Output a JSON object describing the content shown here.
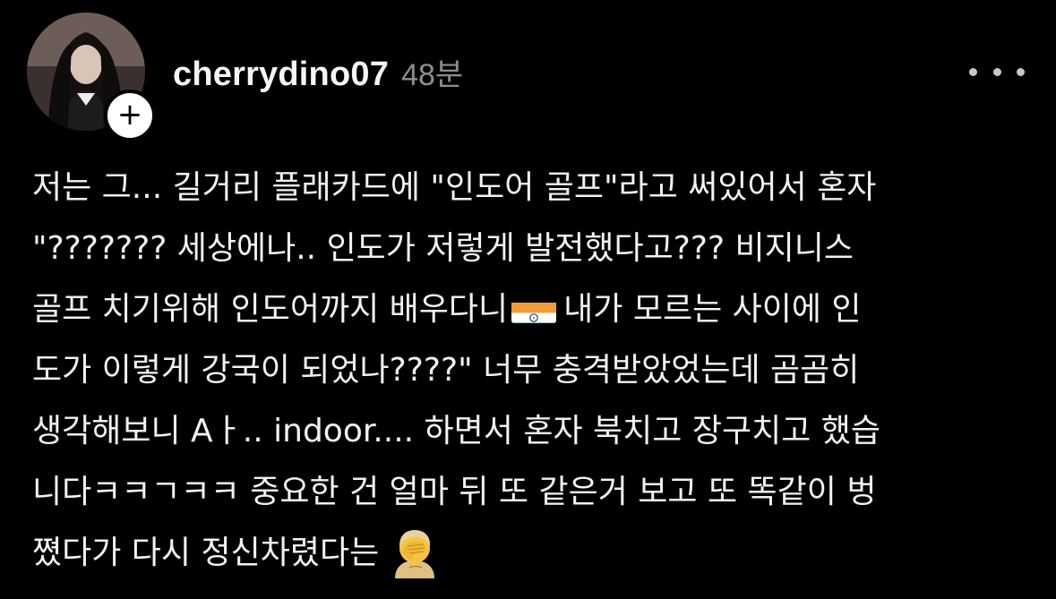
{
  "post": {
    "username": "cherrydino07",
    "time": "48분",
    "follow_symbol": "+",
    "lines": [
      "저는 그... 길거리 플래카드에 \"인도어 골프\"라고 써있어서 혼자",
      "\"??????? 세상에나.. 인도가 저렇게 발전했다고??? 비지니스",
      "골프 치기위해 인도어까지 배우다니",
      "내가 모르는 사이에 인",
      "도가 이렇게 강국이 되었나????\" 너무 충격받았었는데 곰곰히",
      "생각해보니 Aㅏ.. indoor.... 하면서 혼자 북치고 장구치고 했습",
      "니다ㅋㅋㄱㅋㅋ 중요한 건 얼마 뒤 또 같은거 보고 또 똑같이 벙",
      "쪘다가 다시 정신차렸다는"
    ],
    "icons": {
      "follow": "plus-icon",
      "more": "more-horizontal-icon",
      "flag": "india-flag-emoji",
      "facepalm": "facepalm-emoji"
    }
  }
}
